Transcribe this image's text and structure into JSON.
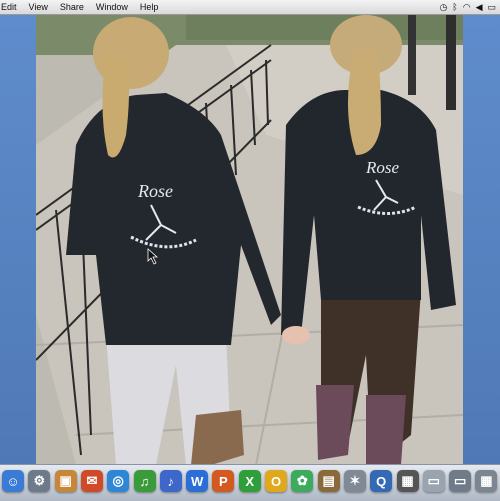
{
  "menubar": {
    "items": [
      "Edit",
      "View",
      "Share",
      "Window",
      "Help"
    ],
    "status_icons": [
      "clock-icon",
      "bluetooth-icon",
      "wifi-icon",
      "volume-icon",
      "battery-icon"
    ]
  },
  "photo": {
    "logo_text_left": "Rose",
    "logo_text_right": "Rose"
  },
  "dock": {
    "icons": [
      {
        "name": "finder-icon",
        "glyph": "☺",
        "color": "#3a7bd5"
      },
      {
        "name": "system-preferences-icon",
        "glyph": "⚙",
        "color": "#6c7a89"
      },
      {
        "name": "iphoto-icon",
        "glyph": "▣",
        "color": "#c7873b"
      },
      {
        "name": "ichat-icon",
        "glyph": "✉",
        "color": "#d04a2a"
      },
      {
        "name": "safari-icon",
        "glyph": "◎",
        "color": "#2f86d6"
      },
      {
        "name": "garageband-icon",
        "glyph": "♫",
        "color": "#3b9b3b"
      },
      {
        "name": "itunes-icon",
        "glyph": "♪",
        "color": "#3d67c9"
      },
      {
        "name": "word-icon",
        "glyph": "W",
        "color": "#2b6fd6"
      },
      {
        "name": "powerpoint-icon",
        "glyph": "P",
        "color": "#d25a20"
      },
      {
        "name": "excel-icon",
        "glyph": "X",
        "color": "#2f9e3b"
      },
      {
        "name": "pages-icon",
        "glyph": "O",
        "color": "#e0a81c"
      },
      {
        "name": "keynote-icon",
        "glyph": "✿",
        "color": "#3daa5c"
      },
      {
        "name": "photo-booth-icon",
        "glyph": "▤",
        "color": "#8a6a3a"
      },
      {
        "name": "starfish-icon",
        "glyph": "✶",
        "color": "#7f8a96"
      },
      {
        "name": "quicktime-icon",
        "glyph": "Q",
        "color": "#3569b5"
      },
      {
        "name": "preview-icon",
        "glyph": "▦",
        "color": "#555"
      },
      {
        "name": "document-icon",
        "glyph": "▭",
        "color": "#9aa4b0"
      },
      {
        "name": "screen-icon",
        "glyph": "▭",
        "color": "#6f7b88"
      },
      {
        "name": "trash-icon",
        "glyph": "▦",
        "color": "#7c8690"
      }
    ]
  }
}
